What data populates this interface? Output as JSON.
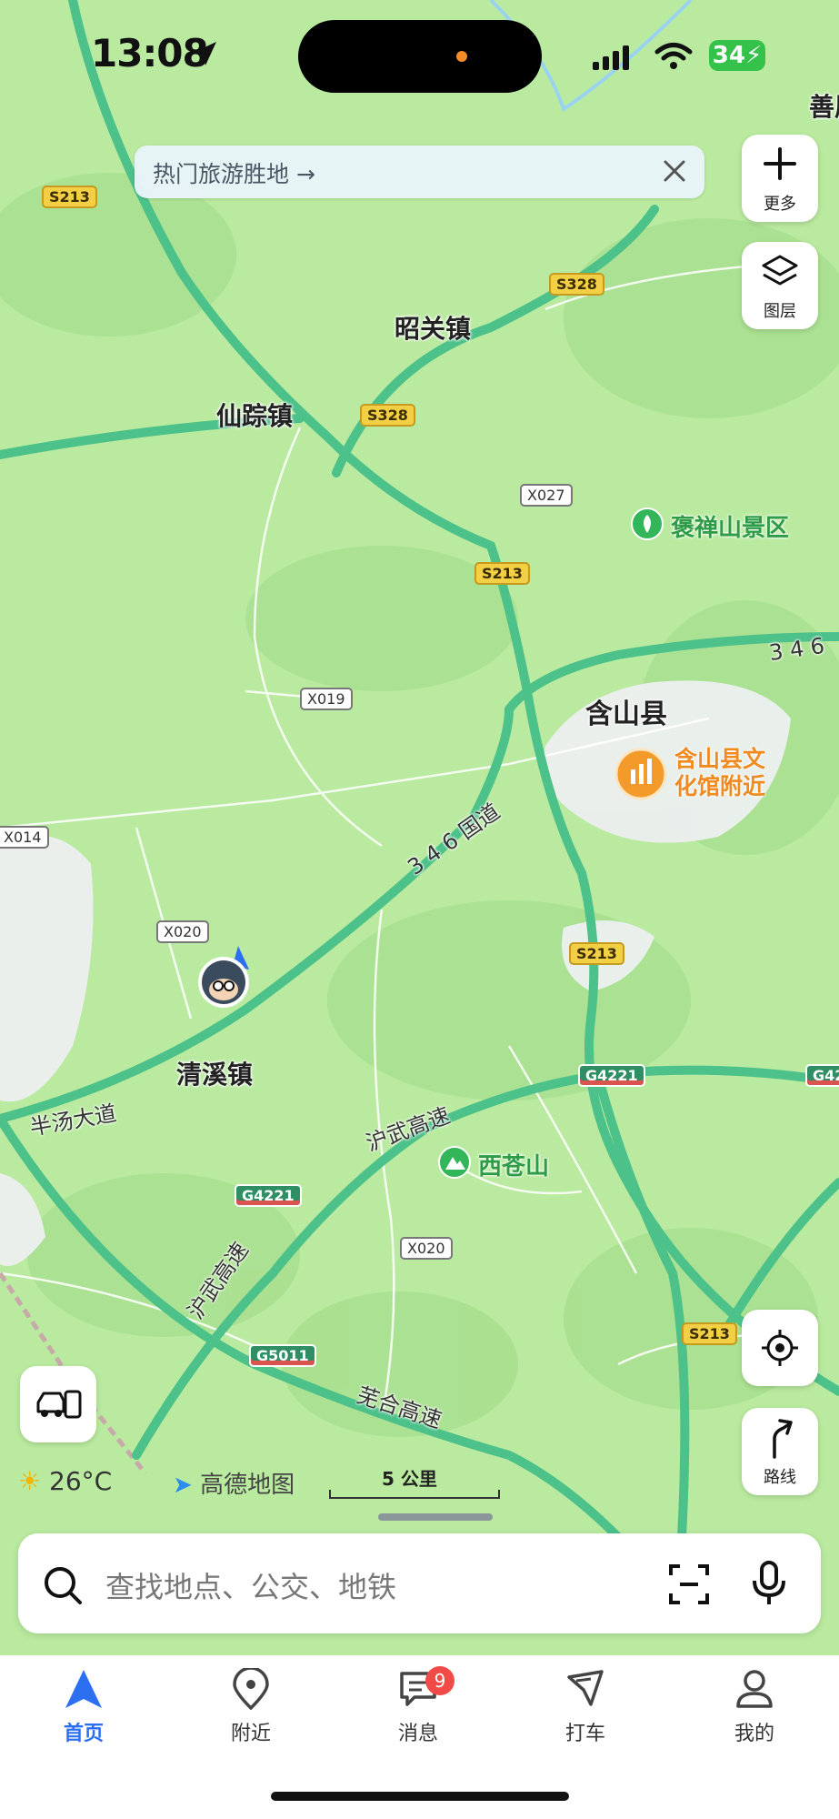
{
  "status": {
    "time": "13:08",
    "battery": "34"
  },
  "banner": {
    "text": "热门旅游胜地 →"
  },
  "controls": {
    "more_label": "更多",
    "layers_label": "图层",
    "route_label": "路线"
  },
  "map": {
    "places": {
      "shanju": "善屈",
      "zhaoguan": "昭关镇",
      "xianzong": "仙踪镇",
      "hanshan": "含山县",
      "qingxi": "清溪镇"
    },
    "pois": {
      "baochan": "褒禅山景区",
      "wenhua": "含山县文化馆附近",
      "xicang": "西苍山"
    },
    "roads": {
      "g346": "3 4 6 国道",
      "g346_east": "3 4 6",
      "huwu1": "沪武高速",
      "huwu2": "沪武高速",
      "wuhe": "芜合高速",
      "bantang": "半汤大道"
    },
    "shields": {
      "s213a": "S213",
      "s328a": "S328",
      "s328b": "S328",
      "x027": "X027",
      "s213b": "S213",
      "x019": "X019",
      "x014": "X014",
      "x020a": "X020",
      "s213c": "S213",
      "g4221a": "G4221",
      "g4221b": "G4221",
      "g4221c": "G42",
      "x020b": "X020",
      "g5011": "G5011",
      "s213d": "S213"
    }
  },
  "weather": {
    "temp": "26°C"
  },
  "brand": {
    "name": "高德地图"
  },
  "scale": {
    "label": "5 公里"
  },
  "search": {
    "placeholder": "查找地点、公交、地铁"
  },
  "tabs": [
    {
      "label": "首页"
    },
    {
      "label": "附近"
    },
    {
      "label": "消息",
      "badge": "9"
    },
    {
      "label": "打车"
    },
    {
      "label": "我的"
    }
  ],
  "colors": {
    "accent": "#2c6ff0",
    "road": "#4cc18a",
    "land": "#b9ea9f",
    "badge": "#f24a47"
  }
}
